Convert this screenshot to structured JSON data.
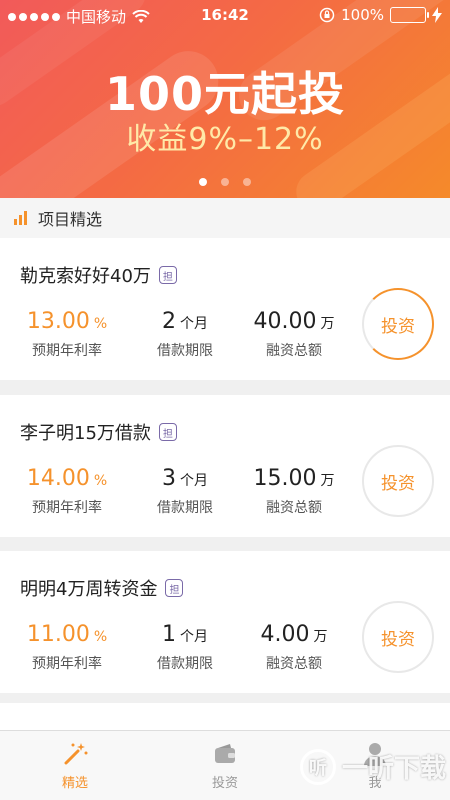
{
  "status_bar": {
    "carrier": "中国移动",
    "time": "16:42",
    "battery": "100%"
  },
  "banner": {
    "title": "100元起投",
    "subtitle": "收益9%–12%",
    "page_count": 3,
    "active_page": 1
  },
  "section": {
    "title": "项目精选"
  },
  "projects": [
    {
      "name": "勒克索好好40万",
      "badge": "担",
      "rate": "13.00",
      "rate_unit": "%",
      "rate_label": "预期年利率",
      "term": "2",
      "term_unit": "个月",
      "term_label": "借款期限",
      "amount": "40.00",
      "amount_unit": "万",
      "amount_label": "融资总额",
      "button": "投资"
    },
    {
      "name": "李子明15万借款",
      "badge": "担",
      "rate": "14.00",
      "rate_unit": "%",
      "rate_label": "预期年利率",
      "term": "3",
      "term_unit": "个月",
      "term_label": "借款期限",
      "amount": "15.00",
      "amount_unit": "万",
      "amount_label": "融资总额",
      "button": "投资"
    },
    {
      "name": "明明4万周转资金",
      "badge": "担",
      "rate": "11.00",
      "rate_unit": "%",
      "rate_label": "预期年利率",
      "term": "1",
      "term_unit": "个月",
      "term_label": "借款期限",
      "amount": "4.00",
      "amount_unit": "万",
      "amount_label": "融资总额",
      "button": "投资"
    }
  ],
  "tabs": [
    {
      "label": "精选",
      "icon": "magic-wand-icon",
      "active": true
    },
    {
      "label": "投资",
      "icon": "wallet-icon",
      "active": false
    },
    {
      "label": "我",
      "icon": "user-icon",
      "active": false
    }
  ],
  "watermark": {
    "text": "一听下载",
    "logo": "听"
  },
  "colors": {
    "accent": "#f5922c",
    "banner_start": "#f25a5a",
    "banner_end": "#f58a2a"
  }
}
